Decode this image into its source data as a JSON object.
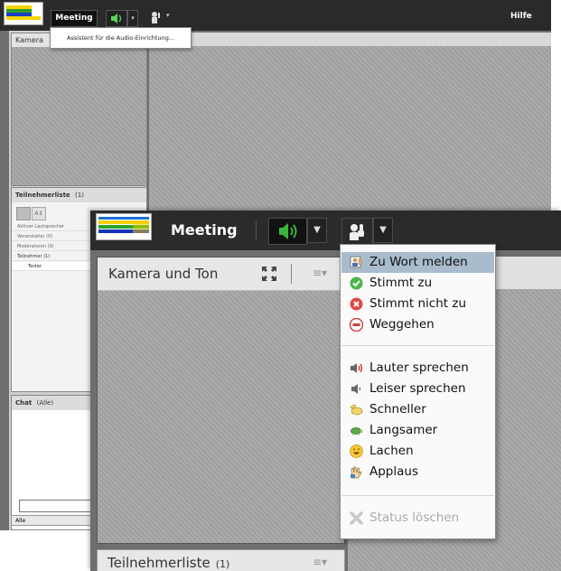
{
  "background_window": {
    "menu_label": "Meeting",
    "help_label": "Hilfe",
    "tooltip": "Assistent für die Audio-Einrichtung...",
    "camera_panel_title": "Kamera",
    "participants_title": "Teilnehmerliste",
    "participants_count": "(1)",
    "rows": [
      "Aktiver Lautsprecher",
      "Veranstalter (0)",
      "Moderatoren (0)",
      "Teilnehmer (1)",
      "Tester"
    ],
    "chat_title": "Chat",
    "chat_scope": "(Alle)",
    "chat_tab": "Alle"
  },
  "main_window": {
    "menu_label": "Meeting",
    "camera_panel_title": "Kamera und Ton",
    "participants_title": "Teilnehmerliste",
    "participants_count": "(1)"
  },
  "status_menu": {
    "items": [
      {
        "label": "Zu Wort melden",
        "icon": "raise-hand-icon",
        "selected": true
      },
      {
        "label": "Stimmt zu",
        "icon": "green-check-icon"
      },
      {
        "label": "Stimmt nicht zu",
        "icon": "red-x-icon"
      },
      {
        "label": "Weggehen",
        "icon": "away-icon"
      },
      {
        "label": "Lauter sprechen",
        "icon": "speaker-loud-icon"
      },
      {
        "label": "Leiser sprechen",
        "icon": "speaker-quiet-icon"
      },
      {
        "label": "Schneller",
        "icon": "rabbit-icon"
      },
      {
        "label": "Langsamer",
        "icon": "turtle-icon"
      },
      {
        "label": "Lachen",
        "icon": "laugh-icon"
      },
      {
        "label": "Applaus",
        "icon": "applause-icon"
      },
      {
        "label": "Status löschen",
        "icon": "clear-status-icon",
        "disabled": true
      }
    ]
  },
  "colors": {
    "menubar": "#2b2b2b",
    "menu_selected": "#a9bccd",
    "audio_green": "#3cb23c",
    "panel_hatch": "#a4a4a4"
  }
}
